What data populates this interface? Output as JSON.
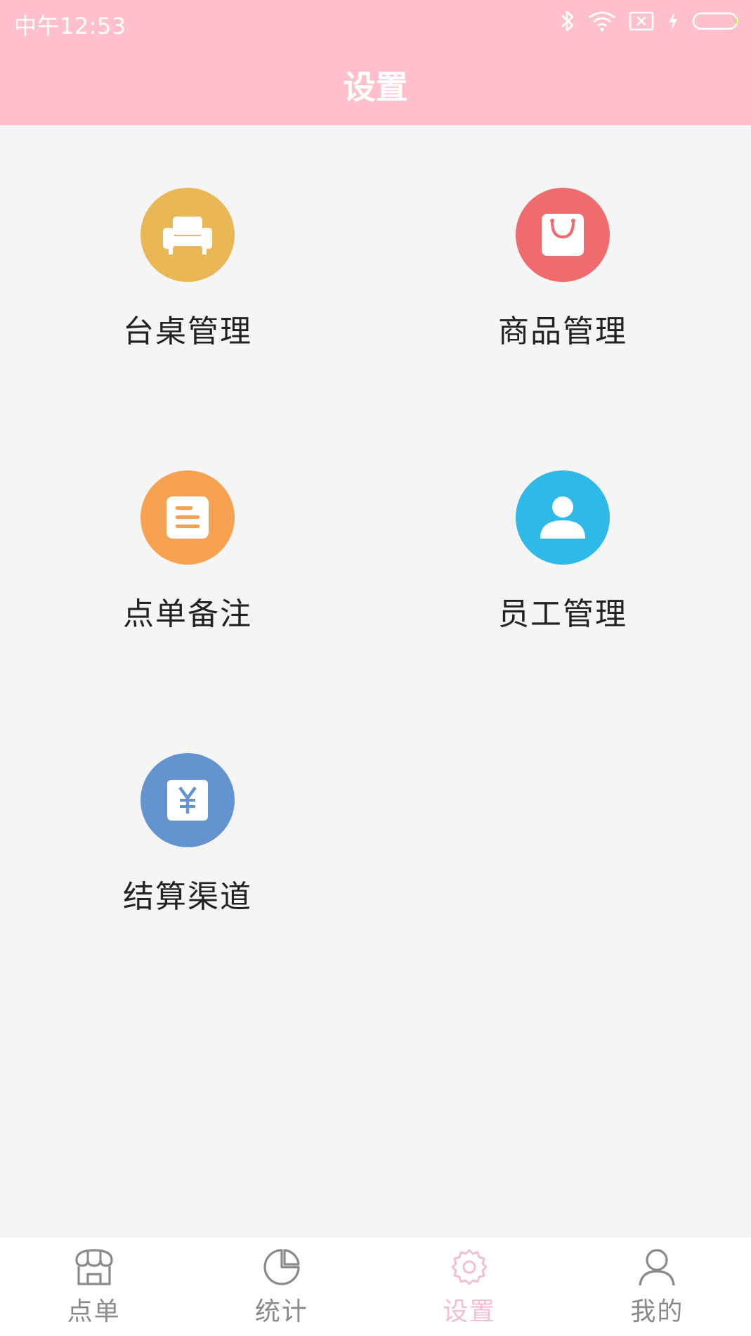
{
  "status_bar": {
    "time": "中午12:53",
    "icons": [
      "bluetooth-icon",
      "wifi-icon",
      "sim-off-icon",
      "charging-icon",
      "battery-icon"
    ]
  },
  "header": {
    "title": "设置"
  },
  "menu": {
    "items": [
      {
        "label": "台桌管理",
        "icon": "sofa-icon",
        "color": "#E9B755"
      },
      {
        "label": "商品管理",
        "icon": "shopping-bag-icon",
        "color": "#EF6B6E"
      },
      {
        "label": "点单备注",
        "icon": "note-icon",
        "color": "#F6A250"
      },
      {
        "label": "员工管理",
        "icon": "person-icon",
        "color": "#2FB9E6"
      },
      {
        "label": "结算渠道",
        "icon": "yuan-icon",
        "color": "#6394D0"
      }
    ]
  },
  "tabbar": {
    "tabs": [
      {
        "label": "点单",
        "icon": "shop-icon"
      },
      {
        "label": "统计",
        "icon": "pie-chart-icon"
      },
      {
        "label": "设置",
        "icon": "gear-icon",
        "active": true
      },
      {
        "label": "我的",
        "icon": "user-icon"
      }
    ]
  },
  "colors": {
    "header_bg": "#FFBFCB",
    "page_bg": "#F5F5F5",
    "tab_active": "#F4BFD0",
    "tab_inactive": "#8A8A8A"
  }
}
